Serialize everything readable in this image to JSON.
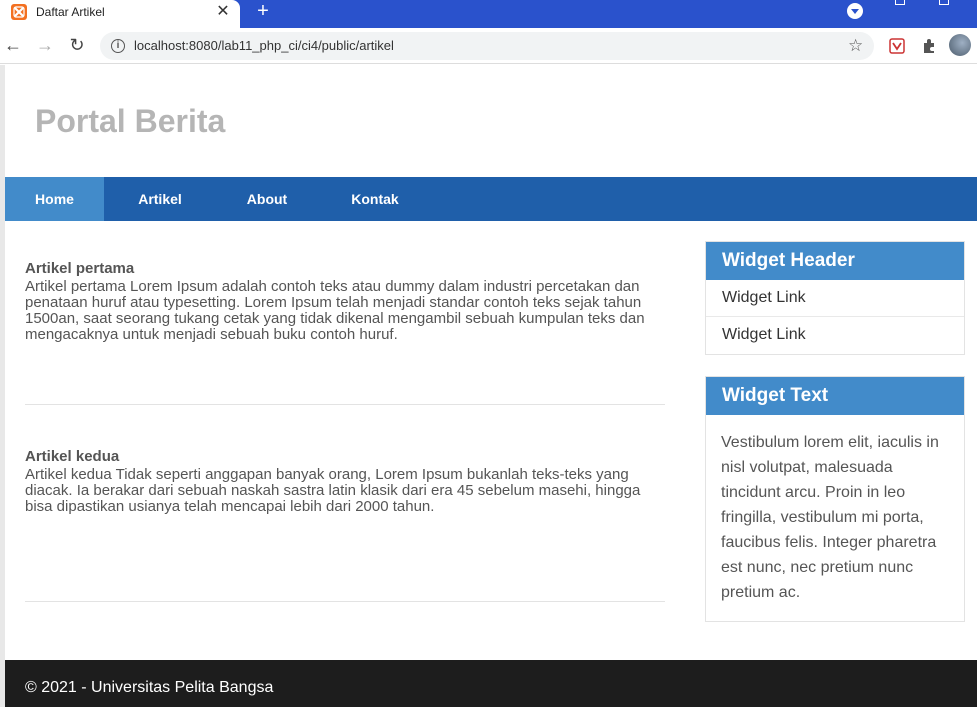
{
  "browser": {
    "tab_title": "Daftar Artikel",
    "tab_close": "✕",
    "new_tab": "+",
    "back": "←",
    "forward": "→",
    "reload": "↻",
    "url": "localhost:8080/lab11_php_ci/ci4/public/artikel",
    "colors": {
      "tabstrip": "#2a52cc"
    }
  },
  "site": {
    "title": "Portal Berita",
    "nav": [
      {
        "label": "Home",
        "active": true
      },
      {
        "label": "Artikel",
        "active": false
      },
      {
        "label": "About",
        "active": false
      },
      {
        "label": "Kontak",
        "active": false
      }
    ],
    "colors": {
      "nav": "#1f5faa",
      "nav_active": "#428bca",
      "widget_header": "#428bca"
    }
  },
  "articles": [
    {
      "title": "Artikel pertama",
      "body": "Artikel pertama Lorem Ipsum adalah contoh teks atau dummy dalam industri percetakan dan penataan huruf atau typesetting. Lorem Ipsum telah menjadi standar contoh teks sejak tahun 1500an, saat seorang tukang cetak yang tidak dikenal mengambil sebuah kumpulan teks dan mengacaknya untuk menjadi sebuah buku contoh huruf."
    },
    {
      "title": "Artikel kedua",
      "body": "Artikel kedua Tidak seperti anggapan banyak orang, Lorem Ipsum bukanlah teks-teks yang diacak. Ia berakar dari sebuah naskah sastra latin klasik dari era 45 sebelum masehi, hingga bisa dipastikan usianya telah mencapai lebih dari 2000 tahun."
    }
  ],
  "sidebar": {
    "widget1": {
      "header": "Widget Header",
      "links": [
        "Widget Link",
        "Widget Link"
      ]
    },
    "widget2": {
      "header": "Widget Text",
      "text": "Vestibulum lorem elit, iaculis in nisl volutpat, malesuada tincidunt arcu. Proin in leo fringilla, vestibulum mi porta, faucibus felis. Integer pharetra est nunc, nec pretium nunc pretium ac."
    }
  },
  "footer": {
    "text": "© 2021 - Universitas Pelita Bangsa"
  }
}
